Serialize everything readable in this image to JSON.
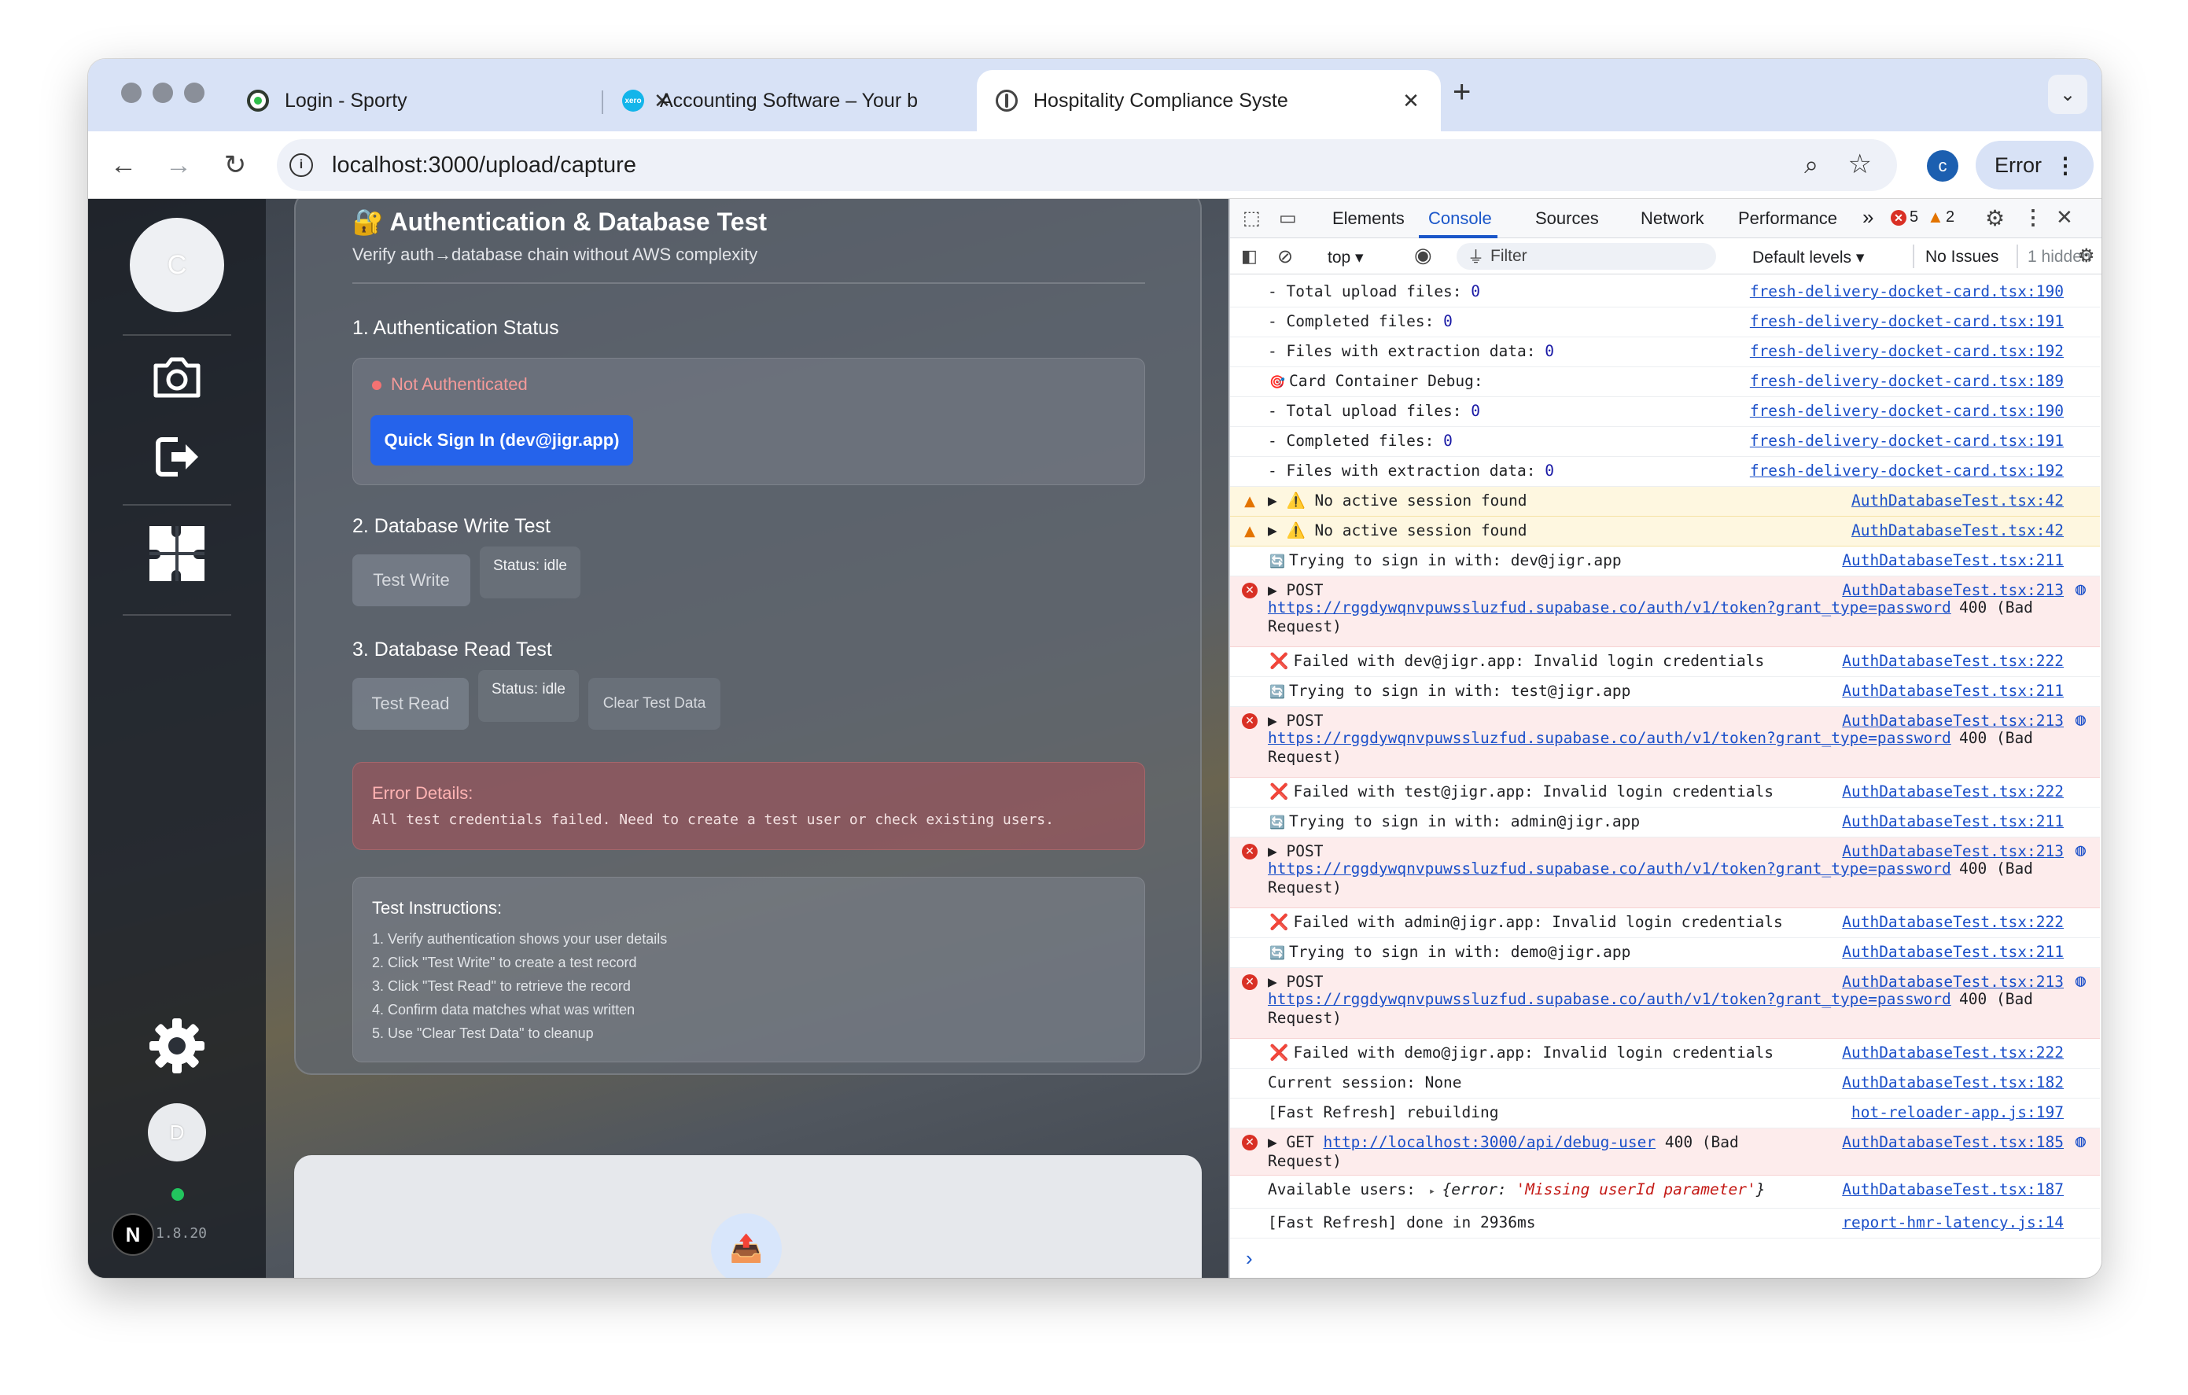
{
  "browser": {
    "tabs": [
      {
        "title": "Login - Sporty",
        "close": "✕"
      },
      {
        "title": "Accounting Software – Your b",
        "close": "✕"
      },
      {
        "title": "Hospitality Compliance Syste",
        "close": "✕"
      }
    ],
    "new_tab": "+",
    "url": "localhost:3000/upload/capture",
    "profile_initial": "c",
    "error_button": "Error"
  },
  "page": {
    "sidebar": {
      "avatar_top": "C",
      "avatar_bottom": "D",
      "version": "1.8.20",
      "next_badge": "N"
    },
    "title": "🔐 Authentication & Database Test",
    "subtitle": "Verify auth→database chain without AWS complexity",
    "auth": {
      "heading": "1. Authentication Status",
      "status": "Not Authenticated",
      "quick_sign_in": "Quick Sign In (dev@jigr.app)"
    },
    "write": {
      "heading": "2. Database Write Test",
      "button": "Test Write",
      "status": "Status: idle"
    },
    "read": {
      "heading": "3. Database Read Test",
      "button": "Test Read",
      "status": "Status: idle",
      "clear": "Clear Test Data"
    },
    "error": {
      "heading": "Error Details:",
      "message": "All test credentials failed. Need to create a test user or check existing users."
    },
    "instructions": {
      "heading": "Test Instructions:",
      "items": [
        "1. Verify authentication shows your user details",
        "2. Click \"Test Write\" to create a test record",
        "3. Click \"Test Read\" to retrieve the record",
        "4. Confirm data matches what was written",
        "5. Use \"Clear Test Data\" to cleanup"
      ]
    }
  },
  "devtools": {
    "tabs": [
      "Elements",
      "Console",
      "Sources",
      "Network",
      "Performance"
    ],
    "more_tabs": "»",
    "error_count": "5",
    "warn_count": "2",
    "context": "top",
    "filter_placeholder": "Filter",
    "levels": "Default levels",
    "issues": "No Issues",
    "hidden": "1 hidden",
    "rows": [
      {
        "type": "log",
        "text": "- Total upload files: ",
        "num": "0",
        "src": "fresh-delivery-docket-card.tsx:190"
      },
      {
        "type": "log",
        "text": "- Completed files: ",
        "num": "0",
        "src": "fresh-delivery-docket-card.tsx:191"
      },
      {
        "type": "log",
        "text": "- Files with extraction data: ",
        "num": "0",
        "src": "fresh-delivery-docket-card.tsx:192"
      },
      {
        "type": "log",
        "icon": "🎯",
        "text": "Card Container Debug:",
        "src": "fresh-delivery-docket-card.tsx:189"
      },
      {
        "type": "log",
        "text": "- Total upload files: ",
        "num": "0",
        "src": "fresh-delivery-docket-card.tsx:190"
      },
      {
        "type": "log",
        "text": "- Completed files: ",
        "num": "0",
        "src": "fresh-delivery-docket-card.tsx:191"
      },
      {
        "type": "log",
        "text": "- Files with extraction data: ",
        "num": "0",
        "src": "fresh-delivery-docket-card.tsx:192"
      },
      {
        "type": "warn",
        "text": "▶ ⚠️ No active session found",
        "src": "AuthDatabaseTest.tsx:42"
      },
      {
        "type": "warn",
        "text": "▶ ⚠️ No active session found",
        "src": "AuthDatabaseTest.tsx:42"
      },
      {
        "type": "log",
        "icon": "🔄",
        "text": "Trying to sign in with: dev@jigr.app",
        "src": "AuthDatabaseTest.tsx:211"
      },
      {
        "type": "err",
        "text": "▶ POST",
        "url": "https://rggdywqnvpuwssluzfud.supabase.co/auth/v1/token?grant_type=password",
        "tail": " 400 (Bad",
        "tail2": "Request)",
        "src": "AuthDatabaseTest.tsx:213"
      },
      {
        "type": "log",
        "icon": "❌",
        "text": "Failed with dev@jigr.app: Invalid login credentials",
        "src": "AuthDatabaseTest.tsx:222"
      },
      {
        "type": "log",
        "icon": "🔄",
        "text": "Trying to sign in with: test@jigr.app",
        "src": "AuthDatabaseTest.tsx:211"
      },
      {
        "type": "err",
        "text": "▶ POST",
        "url": "https://rggdywqnvpuwssluzfud.supabase.co/auth/v1/token?grant_type=password",
        "tail": " 400 (Bad",
        "tail2": "Request)",
        "src": "AuthDatabaseTest.tsx:213"
      },
      {
        "type": "log",
        "icon": "❌",
        "text": "Failed with test@jigr.app: Invalid login credentials",
        "src": "AuthDatabaseTest.tsx:222"
      },
      {
        "type": "log",
        "icon": "🔄",
        "text": "Trying to sign in with: admin@jigr.app",
        "src": "AuthDatabaseTest.tsx:211"
      },
      {
        "type": "err",
        "text": "▶ POST",
        "url": "https://rggdywqnvpuwssluzfud.supabase.co/auth/v1/token?grant_type=password",
        "tail": " 400 (Bad",
        "tail2": "Request)",
        "src": "AuthDatabaseTest.tsx:213"
      },
      {
        "type": "log",
        "icon": "❌",
        "text": "Failed with admin@jigr.app: Invalid login credentials",
        "src": "AuthDatabaseTest.tsx:222"
      },
      {
        "type": "log",
        "icon": "🔄",
        "text": "Trying to sign in with: demo@jigr.app",
        "src": "AuthDatabaseTest.tsx:211"
      },
      {
        "type": "err",
        "text": "▶ POST",
        "url": "https://rggdywqnvpuwssluzfud.supabase.co/auth/v1/token?grant_type=password",
        "tail": " 400 (Bad",
        "tail2": "Request)",
        "src": "AuthDatabaseTest.tsx:213"
      },
      {
        "type": "log",
        "icon": "❌",
        "text": "Failed with demo@jigr.app: Invalid login credentials",
        "src": "AuthDatabaseTest.tsx:222"
      },
      {
        "type": "log",
        "text": "Current session: None",
        "src": "AuthDatabaseTest.tsx:182"
      },
      {
        "type": "log",
        "text": "[Fast Refresh] rebuilding",
        "src": "hot-reloader-app.js:197"
      },
      {
        "type": "err1",
        "text": "▶ GET",
        "url": "http://localhost:3000/api/debug-user",
        "tail": " 400 (Bad",
        "tail2": "Request)",
        "src": "AuthDatabaseTest.tsx:185"
      },
      {
        "type": "obj",
        "text": "Available users:",
        "obj_key": "{error: ",
        "obj_val": "'Missing userId parameter'",
        "obj_end": "}",
        "src": "AuthDatabaseTest.tsx:187"
      },
      {
        "type": "log",
        "text": "[Fast Refresh] done in 2936ms",
        "src": "report-hmr-latency.js:14"
      }
    ],
    "prompt": "›"
  },
  "colors": {
    "tab_strip": "#d8e2f6",
    "primary_button": "#2563eb",
    "error_red": "#d93025",
    "link_blue": "#1a4fc9",
    "warn_bg": "#fef7e0",
    "err_bg": "#fdecec"
  }
}
